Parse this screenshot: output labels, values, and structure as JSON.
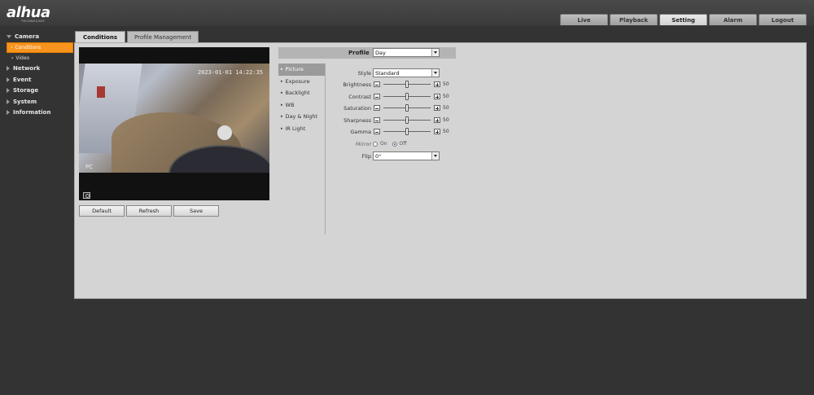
{
  "brand": {
    "logo": "alhua",
    "tagline": "TECHNOLOGY"
  },
  "top_nav": [
    "Live",
    "Playback",
    "Setting",
    "Alarm",
    "Logout"
  ],
  "top_nav_active": "Setting",
  "sidebar": {
    "camera": "Camera",
    "conditions": "Conditions",
    "video": "Video",
    "network": "Network",
    "event": "Event",
    "storage": "Storage",
    "system": "System",
    "information": "Information"
  },
  "tabs": {
    "conditions": "Conditions",
    "profile_management": "Profile Management"
  },
  "video": {
    "timestamp": "2023-01-01 14:22:35",
    "channel_name": "PC"
  },
  "buttons": {
    "default": "Default",
    "refresh": "Refresh",
    "save": "Save"
  },
  "profile": {
    "label": "Profile",
    "value": "Day"
  },
  "submenu": [
    "Picture",
    "Exposure",
    "Backlight",
    "WB",
    "Day & Night",
    "IR Light"
  ],
  "submenu_active": "Picture",
  "picture": {
    "style": {
      "label": "Style",
      "value": "Standard"
    },
    "brightness": {
      "label": "Brightness",
      "value": 50
    },
    "contrast": {
      "label": "Contrast",
      "value": 50
    },
    "saturation": {
      "label": "Saturation",
      "value": 50
    },
    "sharpness": {
      "label": "Sharpness",
      "value": 50
    },
    "gamma": {
      "label": "Gamma",
      "value": 50
    },
    "mirror": {
      "label": "Mirror",
      "on": "On",
      "off": "Off",
      "selected": "Off"
    },
    "flip": {
      "label": "Flip",
      "value": "0°"
    }
  },
  "colors": {
    "accent": "#f7941d",
    "header": "#3f3f3f",
    "panel": "#d4d4d4"
  }
}
